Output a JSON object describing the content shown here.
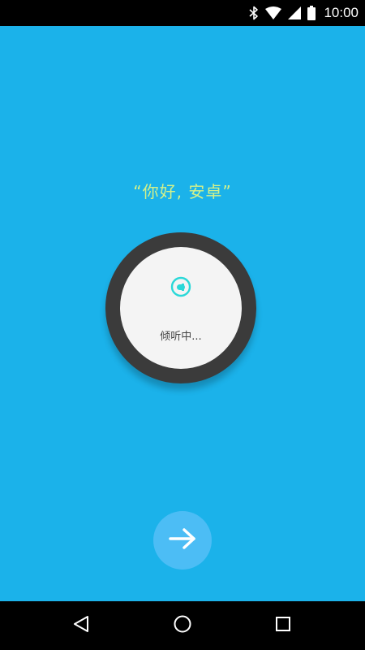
{
  "status_bar": {
    "time": "10:00",
    "icons": [
      "bluetooth-icon",
      "wifi-icon",
      "signal-icon",
      "battery-icon"
    ]
  },
  "prompt": {
    "text": "“你好, 安卓”",
    "color": "#d4f18a"
  },
  "voice_panel": {
    "status_label": "倾听中...",
    "icon": "listening-icon",
    "accent_color": "#2ad8d8"
  },
  "next_button": {
    "icon": "arrow-right-icon"
  },
  "nav_bar": {
    "items": [
      "back-icon",
      "home-icon",
      "recents-icon"
    ]
  },
  "colors": {
    "background": "#1bb2ea",
    "ring": "#3b3b3b",
    "inner": "#f4f4f4",
    "next_button": "#4cbdf5"
  }
}
